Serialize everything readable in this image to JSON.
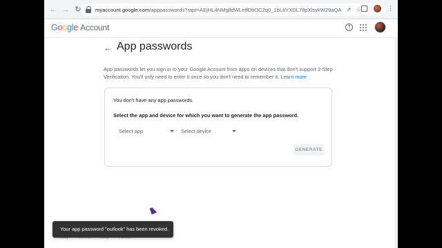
{
  "browser": {
    "url_domain": "myaccount.google.com",
    "url_rest": "/apppasswords?rapt=AEjHL4NMglfdWLetfDbOC2q0_1bLkYXDL78pXlsykW29aQAAaa1q9..."
  },
  "header": {
    "logo": [
      "G",
      "o",
      "o",
      "g",
      "l",
      "e"
    ],
    "account_label": "Account"
  },
  "page": {
    "title": "App passwords",
    "intro": "App passwords let you sign in to your Google Account from apps on devices that don't support 2-Step Verification. You'll only need to enter it once so you don't need to remember it.",
    "learn_more": "Learn more"
  },
  "card": {
    "empty_message": "You don't have any app passwords.",
    "instruction": "Select the app and device for which you want to generate the app password.",
    "select_app": "Select app",
    "select_device": "Select device",
    "generate": "GENERATE"
  },
  "footer": [
    "Privacy",
    "Terms",
    "Help",
    "About"
  ],
  "toast": "Your app password \"outlook\" has been revoked."
}
